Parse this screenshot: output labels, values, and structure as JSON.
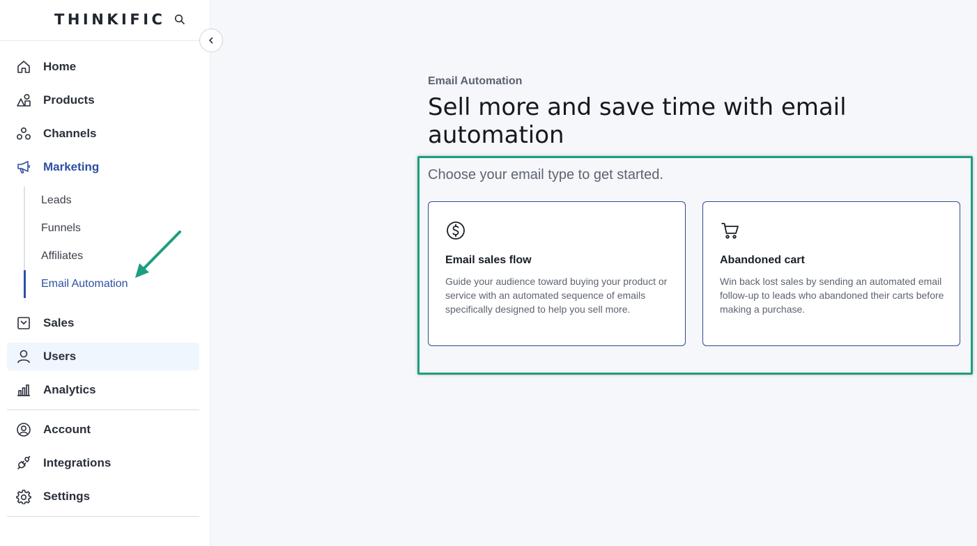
{
  "brand": {
    "logo_text": "THINKIFIC"
  },
  "sidebar": {
    "nav": [
      {
        "label": "Home",
        "icon": "home-icon"
      },
      {
        "label": "Products",
        "icon": "products-icon"
      },
      {
        "label": "Channels",
        "icon": "channels-icon"
      },
      {
        "label": "Marketing",
        "icon": "megaphone-icon",
        "active": true
      }
    ],
    "marketing_sub": [
      {
        "label": "Leads"
      },
      {
        "label": "Funnels"
      },
      {
        "label": "Affiliates"
      },
      {
        "label": "Email Automation",
        "active": true
      }
    ],
    "nav2": [
      {
        "label": "Sales",
        "icon": "sales-icon"
      },
      {
        "label": "Users",
        "icon": "user-icon"
      },
      {
        "label": "Analytics",
        "icon": "analytics-icon"
      }
    ],
    "nav3": [
      {
        "label": "Account",
        "icon": "account-icon"
      },
      {
        "label": "Integrations",
        "icon": "plug-icon"
      },
      {
        "label": "Settings",
        "icon": "gear-icon"
      }
    ]
  },
  "main": {
    "eyebrow": "Email Automation",
    "title": "Sell more and save time with email automation",
    "subtitle": "Choose your email type to get started.",
    "cards": [
      {
        "title": "Email sales flow",
        "description": "Guide your audience toward buying your product or service with an automated sequence of emails specifically designed to help you sell more.",
        "icon": "dollar-circle-icon"
      },
      {
        "title": "Abandoned cart",
        "description": "Win back lost sales by sending an automated email follow-up to leads who abandoned their carts before making a purchase.",
        "icon": "cart-icon"
      }
    ]
  },
  "colors": {
    "accent": "#2e4fa3",
    "annotation": "#1c9e80",
    "card_border": "#2e4a8c",
    "background": "#f5f7fb"
  }
}
